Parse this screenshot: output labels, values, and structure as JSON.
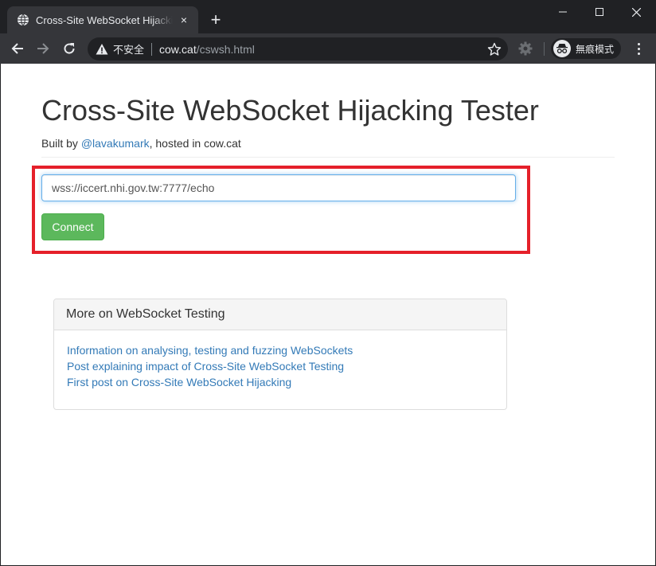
{
  "browser": {
    "tab_title": "Cross-Site WebSocket Hijacking Tester",
    "tab_close": "×",
    "new_tab": "+",
    "security_label": "不安全",
    "url_host": "cow.cat",
    "url_path": "/cswsh.html",
    "incognito_label": "無痕模式"
  },
  "page": {
    "title": "Cross-Site WebSocket Hijacking Tester",
    "byline_prefix": "Built by ",
    "byline_link": "@lavakumark",
    "byline_suffix": ", hosted in cow.cat",
    "ws_url_value": "wss://iccert.nhi.gov.tw:7777/echo",
    "connect_label": "Connect"
  },
  "panel": {
    "heading": "More on WebSocket Testing",
    "links": [
      "Information on analysing, testing and fuzzing WebSockets",
      "Post explaining impact of Cross-Site WebSocket Testing",
      "First post on Cross-Site WebSocket Hijacking"
    ]
  },
  "colors": {
    "accent_link": "#337ab7",
    "connect_green": "#5cb85c",
    "highlight_red": "#e5202a"
  }
}
